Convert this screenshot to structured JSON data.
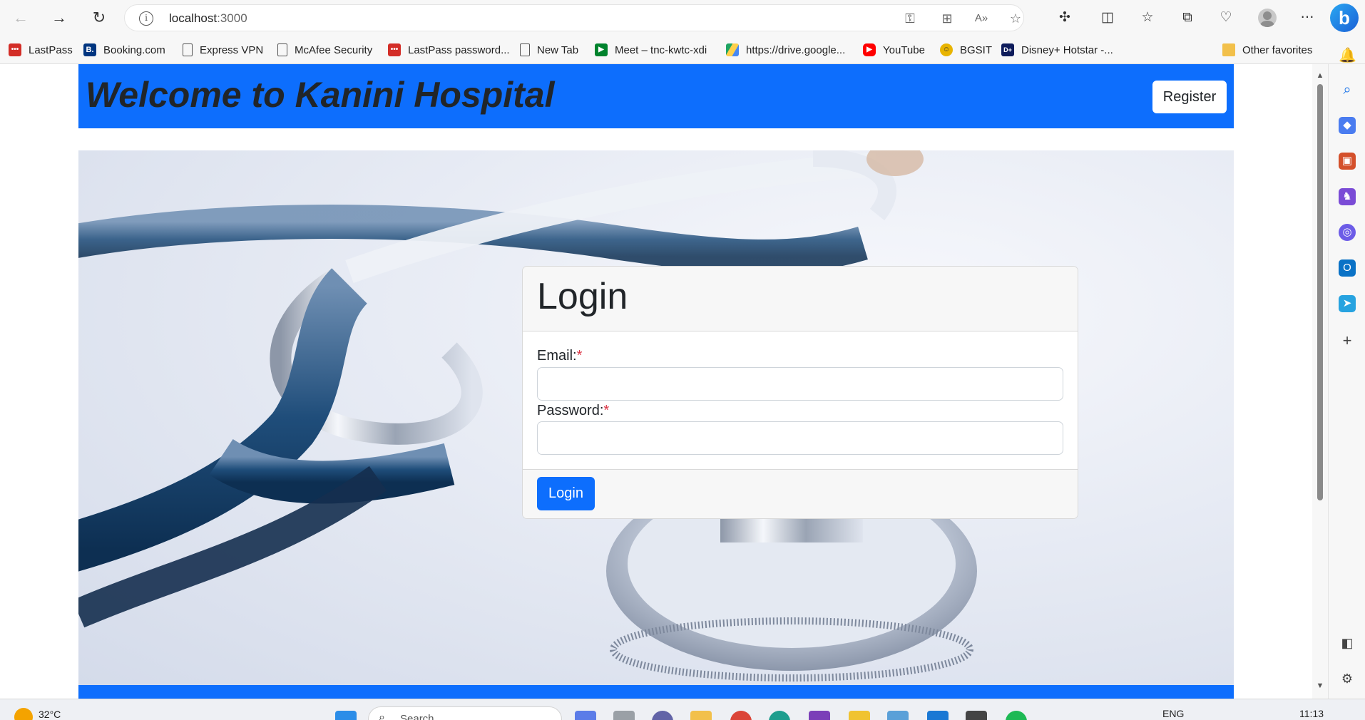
{
  "browser": {
    "url_host": "localhost",
    "url_port": ":3000",
    "profile_icon": "profile-icon",
    "bing_label": "b"
  },
  "favorites": [
    {
      "label": "LastPass",
      "icon": "lastpass-icon",
      "glyph": "•••"
    },
    {
      "label": "Booking.com",
      "icon": "booking-icon",
      "glyph": "B."
    },
    {
      "label": "Express VPN",
      "icon": "page-icon",
      "glyph": ""
    },
    {
      "label": "McAfee Security",
      "icon": "page-icon",
      "glyph": ""
    },
    {
      "label": "LastPass password...",
      "icon": "lastpass-icon",
      "glyph": "•••"
    },
    {
      "label": "New Tab",
      "icon": "page-icon",
      "glyph": ""
    },
    {
      "label": "Meet – tnc-kwtc-xdi",
      "icon": "meet-icon",
      "glyph": "▶"
    },
    {
      "label": "https://drive.google...",
      "icon": "drive-icon",
      "glyph": ""
    },
    {
      "label": "YouTube",
      "icon": "youtube-icon",
      "glyph": "▶"
    },
    {
      "label": "BGSIT",
      "icon": "bgsit-icon",
      "glyph": "☺"
    },
    {
      "label": "Disney+ Hotstar -...",
      "icon": "hotstar-icon",
      "glyph": "D+"
    }
  ],
  "other_favorites": "Other favorites",
  "header": {
    "title": "Welcome to Kanini Hospital",
    "register_label": "Register"
  },
  "login": {
    "title": "Login",
    "email_label": "Email:",
    "password_label": "Password:",
    "required_mark": "*",
    "email_value": "",
    "password_value": "",
    "submit_label": "Login"
  },
  "taskbar": {
    "temperature": "32°C",
    "search_placeholder": "Search",
    "language": "ENG",
    "time": "11:13"
  },
  "colors": {
    "primary": "#0d6efd",
    "required": "#dc3545",
    "title_text": "#212529"
  }
}
